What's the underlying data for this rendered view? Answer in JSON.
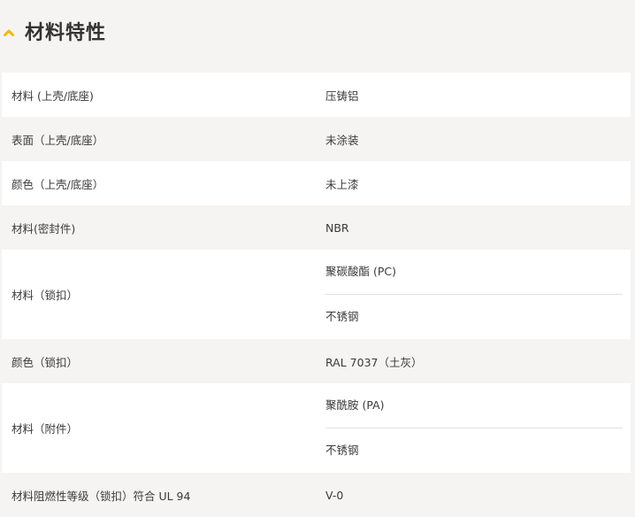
{
  "section": {
    "title": "材料特性",
    "icon": "chevron-up-icon",
    "accent": "#f5b800"
  },
  "rows": [
    {
      "label": "材料 (上壳/底座)",
      "values": [
        "压铸铝"
      ]
    },
    {
      "label": "表面（上壳/底座）",
      "values": [
        "未涂装"
      ]
    },
    {
      "label": "颜色（上壳/底座）",
      "values": [
        "未上漆"
      ]
    },
    {
      "label": "材料(密封件)",
      "values": [
        "NBR"
      ]
    },
    {
      "label": "材料（锁扣）",
      "values": [
        "聚碳酸酯 (PC)",
        "不锈钢"
      ]
    },
    {
      "label": "颜色（锁扣）",
      "values": [
        "RAL 7037（土灰）"
      ]
    },
    {
      "label": "材料（附件）",
      "values": [
        "聚酰胺 (PA)",
        "不锈钢"
      ]
    },
    {
      "label": "材料阻燃性等级（锁扣）符合 UL 94",
      "values": [
        "V-0"
      ]
    }
  ]
}
